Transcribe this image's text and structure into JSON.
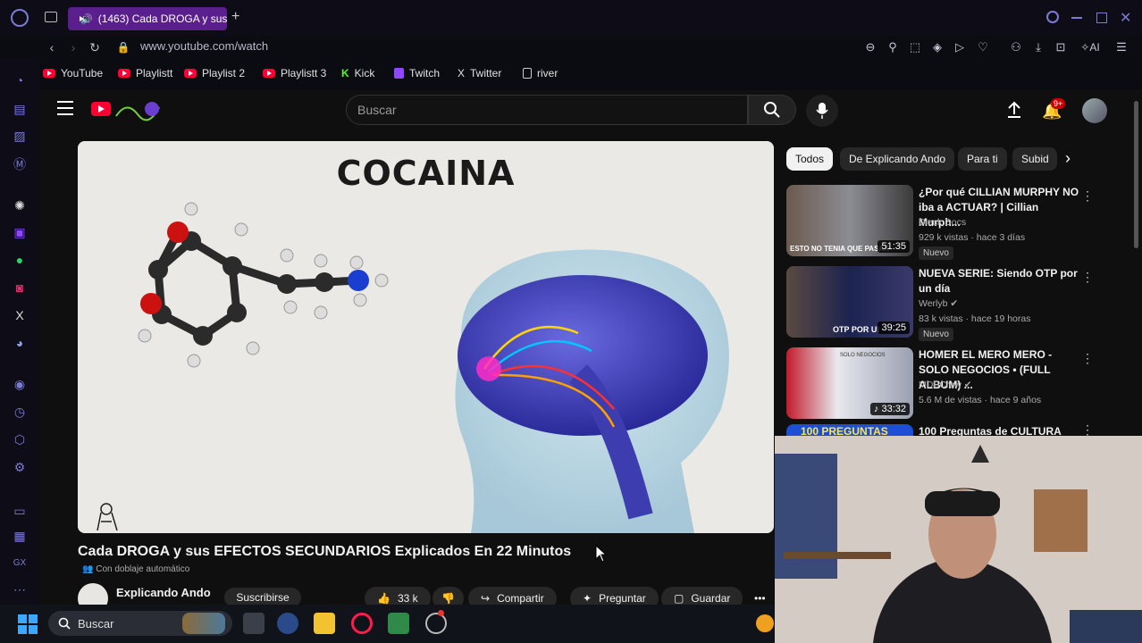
{
  "browser": {
    "tab_title": "(1463) Cada DROGA y sus",
    "new_tab": "+",
    "url": "www.youtube.com/watch",
    "ai_label": "AI",
    "bookmarks": [
      {
        "label": "YouTube",
        "icon": "youtube-icon"
      },
      {
        "label": "Playlistt",
        "icon": "youtube-icon"
      },
      {
        "label": "Playlist 2",
        "icon": "youtube-icon"
      },
      {
        "label": "Playlistt 3",
        "icon": "youtube-icon"
      },
      {
        "label": "Kick",
        "icon": "kick-icon"
      },
      {
        "label": "Twitch",
        "icon": "twitch-icon"
      },
      {
        "label": "Twitter",
        "icon": "x-icon"
      },
      {
        "label": "river",
        "icon": "page-icon"
      }
    ]
  },
  "youtube": {
    "search_placeholder": "Buscar",
    "notifications_badge": "9+",
    "video": {
      "overlay_title": "COCAINA",
      "title": "Cada DROGA y sus EFECTOS SECUNDARIOS Explicados En 22 Minutos",
      "dub_label": "Con doblaje automático",
      "channel": "Explicando Ando",
      "subscribe": "Suscribirse",
      "likes": "33 k",
      "share": "Compartir",
      "ask": "Preguntar",
      "save": "Guardar"
    },
    "chips": [
      "Todos",
      "De Explicando Ando",
      "Para ti",
      "Subid"
    ],
    "suggestions": [
      {
        "title": "¿Por qué CILLIAN MURPHY NO iba a ACTUAR? | Cillian Murph...",
        "channel": "Dieck Docs",
        "meta": "929 k vistas · hace 3 días",
        "badge": "Nuevo",
        "duration": "51:35",
        "thumb_caption": "ESTO NO TENIA QUE PASAR"
      },
      {
        "title": "NUEVA SERIE: Siendo OTP por un día",
        "channel": "Werlyb",
        "meta": "83 k vistas · hace 19 horas",
        "badge": "Nuevo",
        "duration": "39:25",
        "thumb_caption": "OTP POR UI"
      },
      {
        "title": "HOMER EL MERO MERO - SOLO NEGOCIOS • (FULL ALBUM) ...",
        "channel": "MDBCrew",
        "meta": "5.6 M de vistas · hace 9 años",
        "badge": "",
        "duration": "33:32",
        "thumb_caption": "SOLO NEGOCIOS"
      },
      {
        "title": "100 Preguntas de CULTURA",
        "channel": "",
        "meta": "",
        "badge": "",
        "duration": "",
        "thumb_caption": "100 PREGUNTAS"
      }
    ]
  },
  "taskbar": {
    "search_placeholder": "Buscar"
  },
  "colors": {
    "opera_accent": "#5a1f8d",
    "yt_red": "#ff0033",
    "page_bg": "#0f0f0f"
  }
}
